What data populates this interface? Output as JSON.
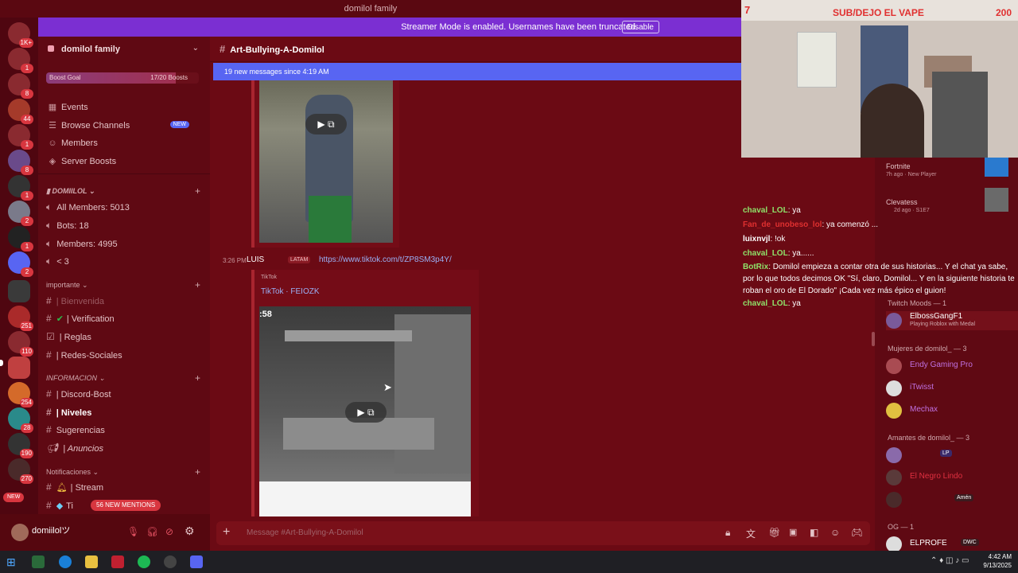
{
  "window": {
    "title": "domilol family"
  },
  "banner": {
    "text": "Streamer Mode is enabled. Usernames have been truncated.",
    "button": "Disable"
  },
  "rail": {
    "badges": [
      "1K+",
      "1",
      "8",
      "44",
      "1",
      "8",
      "1",
      "2",
      "1",
      "2",
      "251",
      "110",
      "254",
      "28",
      "190",
      "270"
    ],
    "new_label": "NEW"
  },
  "sidebar": {
    "server_name": "domilol family",
    "boost_goal": {
      "label": "Boost Goal",
      "progress": "17/20 Boosts"
    },
    "nav": [
      {
        "label": "Events",
        "icon": "calendar-icon"
      },
      {
        "label": "Browse Channels",
        "icon": "browse-icon",
        "badge": "NEW"
      },
      {
        "label": "Members",
        "icon": "members-icon"
      },
      {
        "label": "Server Boosts",
        "icon": "boost-icon"
      }
    ],
    "stats_category": "DOMIILOL",
    "stats": [
      "All Members: 5013",
      "Bots: 18",
      "Members: 4995",
      "< 3"
    ],
    "cat_importante": "importante",
    "importante": [
      "| Bienvenida",
      "| Verification",
      "| Reglas",
      "| Redes-Sociales"
    ],
    "cat_informacion": "INFORMACION",
    "informacion": [
      "| Discord-Bost",
      "| Niveles",
      "Sugerencias",
      "| Anuncios"
    ],
    "cat_notificaciones": "Notificaciones",
    "notificaciones": [
      "| Stream",
      "Ti"
    ],
    "mentions": "56 NEW MENTIONS"
  },
  "user": {
    "name": "domiilolツ"
  },
  "chat": {
    "channel": "Art-Bullying-A-Domilol",
    "new_messages": "19 new messages since 4:19 AM",
    "msg_time": "3:26 PM",
    "msg_author": "LUIS",
    "msg_tag": "LATAM",
    "msg_link": "https://www.tiktok.com/t/ZP8SM3p4Y/",
    "embed_provider": "TikTok",
    "embed_title": "TikTok · FEIOZK",
    "video_timer": ":58",
    "composer_placeholder": "Message #Art-Bullying-A-Domilol"
  },
  "stream": {
    "left_count": "7",
    "title": "SUB/DEJO EL VAPE",
    "right_count": "200"
  },
  "overlay_chat": [
    {
      "user": "chaval_LOL",
      "text": ": ya",
      "color": "#8fe36a"
    },
    {
      "user": "Fan_de_unobeso_lol",
      "text": ": ya comenzó ...",
      "color": "#e03030"
    },
    {
      "user": "luixnvjl",
      "text": ": !ok",
      "color": "#ffffff"
    },
    {
      "user": "chaval_LOL",
      "text": ": ya......",
      "color": "#8fe36a"
    },
    {
      "user": "BotRix",
      "text": ": Domilol empieza a contar otra de sus historias... Y el chat ya sabe, por lo que todos decimos OK \"Sí, claro, Domilol... Y en la siguiente historia te roban el oro de El Dorado\" ¡Cada vez más épico el guion!",
      "color": "#8fe36a"
    },
    {
      "user": "chaval_LOL",
      "text": ": ya",
      "color": "#8fe36a"
    }
  ],
  "members": {
    "top_activity": [
      {
        "name": "Fortnite",
        "meta": "7h ago · New Player"
      },
      {
        "name": "Clevatess",
        "meta": "2d ago · S1E7"
      }
    ],
    "cat_twitch_mods": "Twitch Moods — 1",
    "twitch_mods": [
      {
        "name": "ElbossGangF1",
        "status": "Playing Roblox with Medal"
      }
    ],
    "cat_mujeres": "Mujeres de domilol_ — 3",
    "mujeres": [
      "Endy Gaming Pro",
      "iTwisst",
      "Mechax"
    ],
    "cat_amantes": "Amantes de domilol_ — 3",
    "amantes": [
      "",
      "El Negro Lindo",
      ""
    ],
    "amen": "Amén",
    "lp": "LP",
    "cat_og": "OG — 1",
    "og": [
      {
        "name": "ELPROFE",
        "tag": "DWC"
      }
    ]
  },
  "taskbar": {
    "time": "4:42 AM",
    "date": "9/13/2025"
  }
}
